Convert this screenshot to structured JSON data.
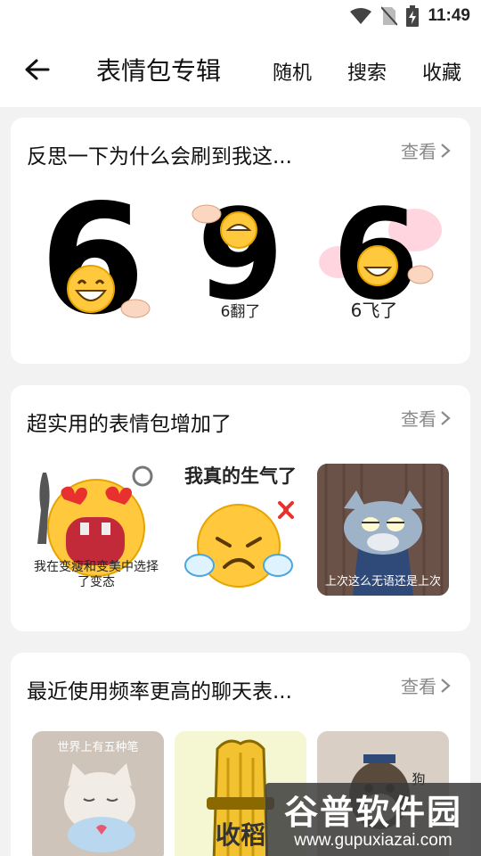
{
  "status_bar": {
    "time": "11:49",
    "icons": [
      "wifi-icon",
      "no-sim-icon",
      "battery-charging-icon"
    ]
  },
  "header": {
    "title": "表情包专辑",
    "actions": [
      "随机",
      "搜索",
      "收藏"
    ]
  },
  "cards": [
    {
      "title": "反思一下为什么会刷到我这...",
      "more": "查看",
      "stickers": [
        {
          "kind": "big-number-six-grin",
          "text": ""
        },
        {
          "kind": "big-number-nine-grin",
          "text": "6翻了"
        },
        {
          "kind": "big-number-six-winged",
          "text": "6飞了"
        }
      ]
    },
    {
      "title": "超实用的表情包增加了",
      "more": "查看",
      "stickers": [
        {
          "kind": "heart-eyes-emoji",
          "text": "我在变瘦和变美中选择了变态"
        },
        {
          "kind": "angry-emoji",
          "text": "我真的生气了"
        },
        {
          "kind": "tom-cat",
          "text": "上次这么无语还是上次"
        }
      ]
    },
    {
      "title": "最近使用频率更高的聊天表...",
      "more": "查看",
      "stickers": [
        {
          "kind": "kitten-pens",
          "text": "世界上有五种笔"
        },
        {
          "kind": "wheat-bundle",
          "text": "收稻"
        },
        {
          "kind": "dog-photo",
          "text": "狗"
        }
      ]
    }
  ],
  "watermark": {
    "text": "谷普软件园",
    "url": "www.gupuxiazai.com"
  },
  "colors": {
    "background": "#f2f2f2",
    "card": "#ffffff",
    "muted": "#8a8a8a",
    "emoji_yellow": "#ffc83d"
  }
}
